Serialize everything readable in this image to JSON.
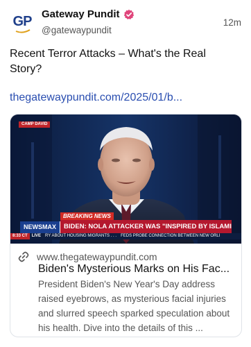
{
  "author": {
    "avatar_text": "GP",
    "display_name": "Gateway Pundit",
    "handle": "@gatewaypundit",
    "verified": true,
    "avatar_icon": "gateway-pundit-logo",
    "verified_icon": "verified-badge-icon"
  },
  "post": {
    "time": "12m",
    "text": "Recent Terror Attacks – What's the Real Story?",
    "link": "thegatewaypundit.com/2025/01/b..."
  },
  "link_card": {
    "image": {
      "corner_tag": "CAMP DAVID",
      "breaking_label": "BREAKING NEWS",
      "network_logo": "NEWSMAX",
      "headline": "BIDEN: NOLA ATTACKER WAS \"INSPIRED BY ISLAMIC STATE\"",
      "ticker_clock": "8:33 CT",
      "ticker_live": "LIVE",
      "ticker_items": [
        "RY ABOUT HOUSING MIGRANTS . . .",
        "FEDS PROBE CONNECTION BETWEEN NEW ORLI"
      ]
    },
    "link_icon": "link-icon",
    "domain": "www.thegatewaypundit.com",
    "title": "Biden's Mysterious Marks on His Fac...",
    "description": "President Biden's New Year's Day address raised eyebrows, as mysterious facial injuries and slurred speech sparked speculation about his health. Dive into the details of this ..."
  },
  "colors": {
    "brand_blue": "#1f3f8a",
    "link_blue": "#2a4eb0",
    "verified_pink": "#e0457b",
    "breaking_red": "#b4182e"
  }
}
